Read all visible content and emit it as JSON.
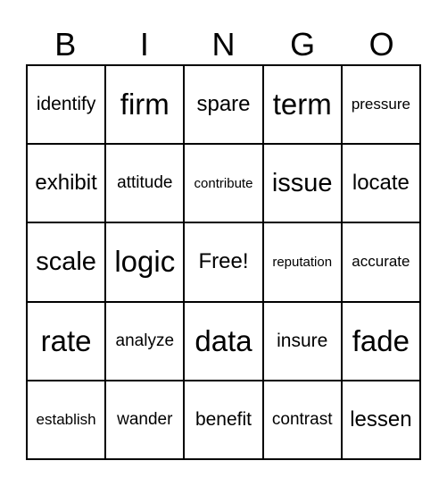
{
  "header": {
    "letters": [
      "B",
      "I",
      "N",
      "G",
      "O"
    ]
  },
  "card": {
    "rows": [
      [
        "identify",
        "firm",
        "spare",
        "term",
        "pressure"
      ],
      [
        "exhibit",
        "attitude",
        "contribute",
        "issue",
        "locate"
      ],
      [
        "scale",
        "logic",
        "Free!",
        "reputation",
        "accurate"
      ],
      [
        "rate",
        "analyze",
        "data",
        "insure",
        "fade"
      ],
      [
        "establish",
        "wander",
        "benefit",
        "contrast",
        "lessen"
      ]
    ]
  }
}
